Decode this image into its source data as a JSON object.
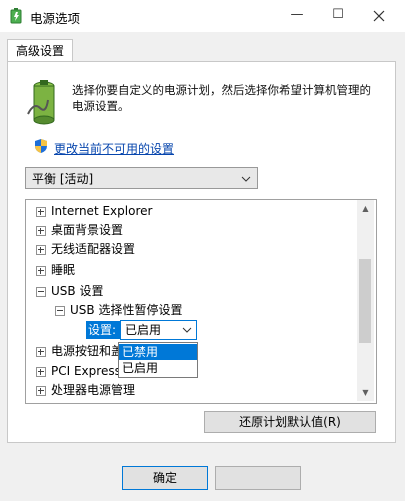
{
  "window": {
    "title": "电源选项",
    "minimize_glyph": "—",
    "maximize_glyph": "☐"
  },
  "tab": {
    "label": "高级设置"
  },
  "description": "选择你要自定义的电源计划，然后选择你希望计算机管理的电源设置。",
  "change_link": "更改当前不可用的设置",
  "plan_select": {
    "value": "平衡 [活动]"
  },
  "tree": {
    "items": [
      {
        "label": "Internet Explorer",
        "state": "collapsed"
      },
      {
        "label": "桌面背景设置",
        "state": "collapsed"
      },
      {
        "label": "无线适配器设置",
        "state": "collapsed"
      },
      {
        "label": "睡眠",
        "state": "collapsed"
      },
      {
        "label": "USB 设置",
        "state": "expanded"
      },
      {
        "label": "USB 选择性暂停设置",
        "state": "expanded"
      },
      {
        "label": "电源按钮和盖",
        "state": "collapsed"
      },
      {
        "label": "PCI Express",
        "state": "collapsed"
      },
      {
        "label": "处理器电源管理",
        "state": "collapsed"
      }
    ],
    "setting_label": "设置:",
    "setting_value": "已启用"
  },
  "dropdown": {
    "options": [
      "已禁用",
      "已启用"
    ],
    "highlighted": "已禁用"
  },
  "buttons": {
    "restore": "还原计划默认值(R)",
    "ok": "确定"
  },
  "colors": {
    "accent": "#0078d7",
    "link": "#0645ad"
  }
}
